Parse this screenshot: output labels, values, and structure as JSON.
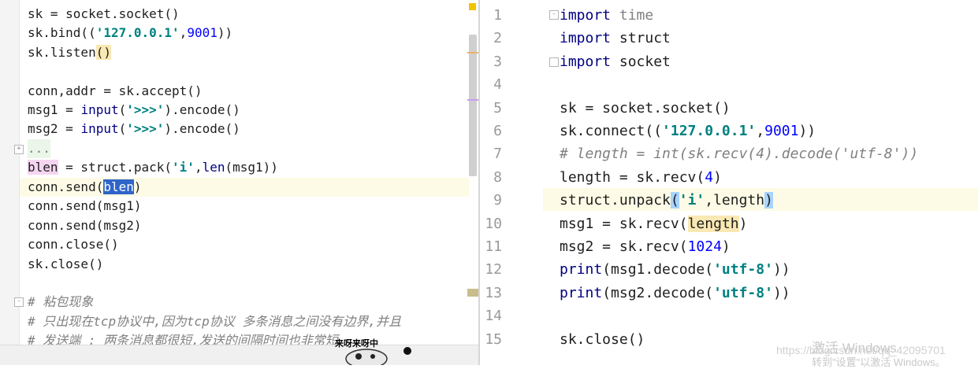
{
  "left_editor": {
    "lines": [
      "sk = socket.socket()",
      "sk.bind(('127.0.0.1',9001))",
      "sk.listen()",
      "",
      "conn,addr = sk.accept()",
      "msg1 = input('>>>').encode()",
      "msg2 = input('>>>').encode()",
      "...",
      "blen = struct.pack('i',len(msg1))",
      "conn.send(blen)",
      "conn.send(msg1)",
      "conn.send(msg2)",
      "conn.close()",
      "sk.close()",
      "",
      "# 粘包现象",
      "# 只出现在tcp协议中,因为tcp协议 多条消息之间没有边界,并且",
      "# 发送端 : 两条消息都很短,发送的间隔时间也非常短"
    ]
  },
  "right_editor": {
    "line_numbers": [
      "1",
      "2",
      "3",
      "4",
      "5",
      "6",
      "7",
      "8",
      "9",
      "10",
      "11",
      "12",
      "13",
      "14",
      "15"
    ],
    "lines": [
      "import time",
      "import struct",
      "import socket",
      "",
      "sk = socket.socket()",
      "sk.connect(('127.0.0.1',9001))",
      "# length = int(sk.recv(4).decode('utf-8'))",
      "length = sk.recv(4)",
      "struct.unpack('i',length)",
      "msg1 = sk.recv(length)",
      "msg2 = sk.recv(1024)",
      "print(msg1.decode('utf-8'))",
      "print(msg2.decode('utf-8'))",
      "",
      "sk.close()"
    ]
  },
  "overlay": {
    "watermark_activate": "激活 Windows",
    "watermark_url": "https://blog.csdn.net/qq_42095701",
    "watermark_settings": "转到\"设置\"以激活 Windows。",
    "sticker_text": "来呀来呀中"
  },
  "colors": {
    "keyword": "#000080",
    "string": "#008080",
    "number": "#0000ff",
    "comment": "#808080",
    "selection": "#2f65ca",
    "current_line": "#fdfbe6"
  }
}
